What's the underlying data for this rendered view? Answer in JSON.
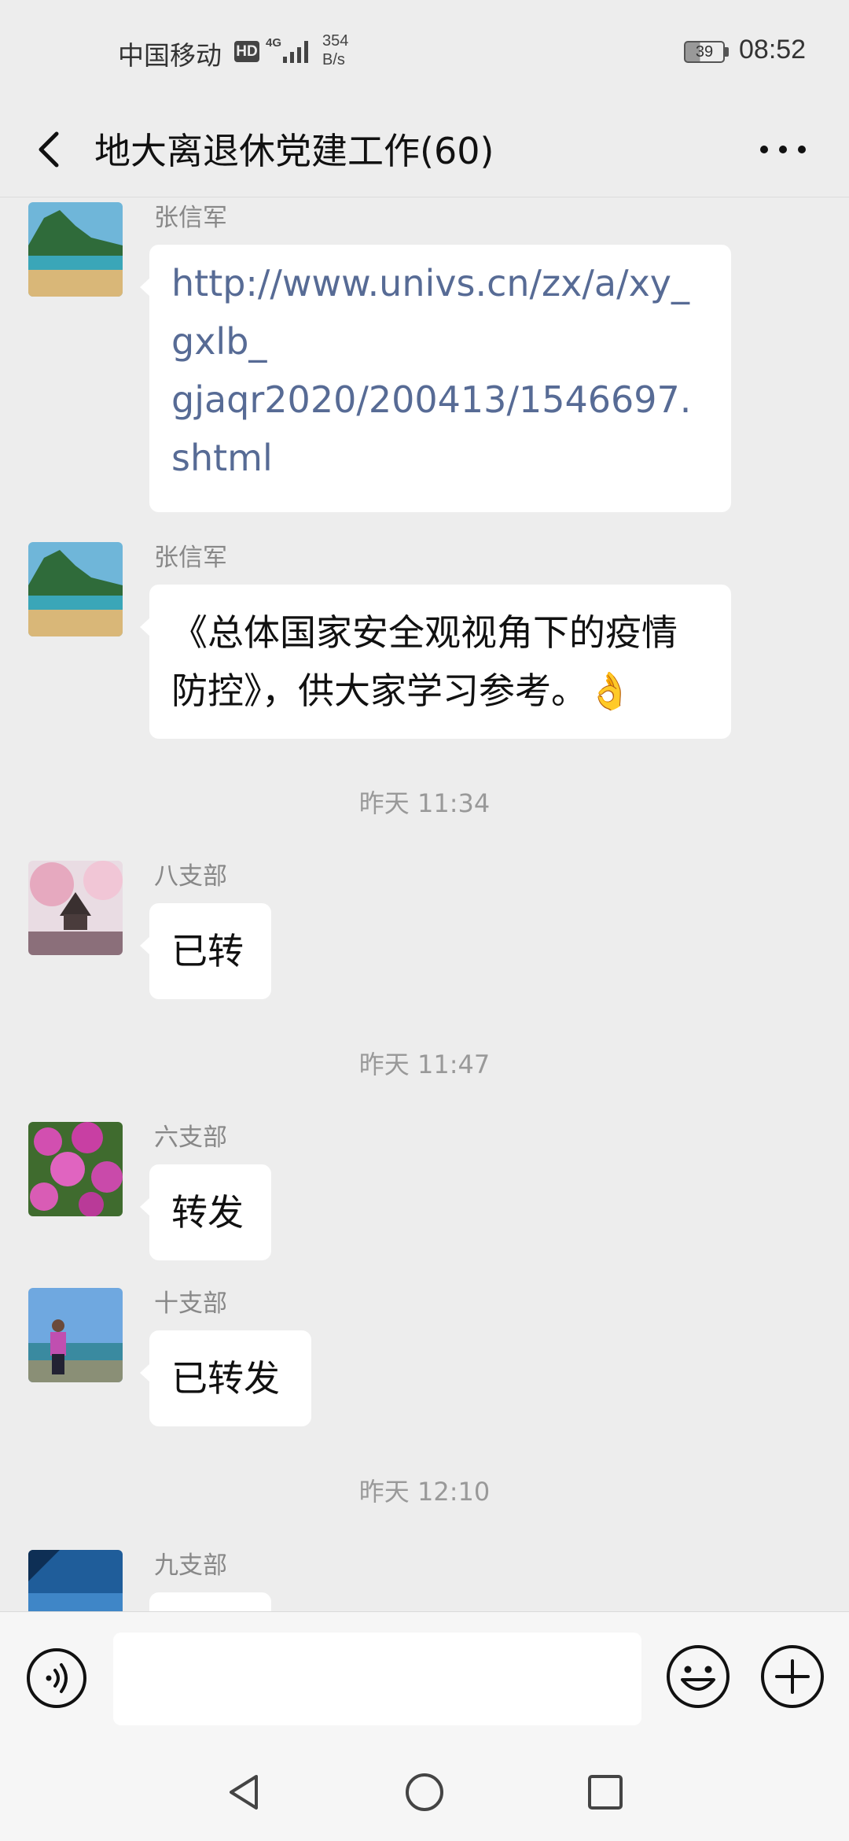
{
  "status_bar": {
    "carrier": "中国移动",
    "hd": "HD",
    "network": "4G",
    "speed_value": "354",
    "speed_unit": "B/s",
    "battery": "39",
    "time": "08:52"
  },
  "header": {
    "title": "地大离退休党建工作(60)"
  },
  "messages": [
    {
      "sender": "张信军",
      "text": "http://www.univs.cn/zx/a/xy_gxlb_gjaqr2020/200413/1546697.shtml",
      "text_lines": [
        "http://www.univs.cn/zx/a/xy_",
        "gxlb_",
        "gjaqr2020/200413/1546697.",
        "shtml"
      ],
      "is_link": true
    },
    {
      "sender": "张信军",
      "text_lines": [
        "《总体国家安全观视角下的疫情",
        "防控》，供大家学习参考。"
      ],
      "emoji": "👌"
    },
    {
      "timestamp": "昨天 11:34"
    },
    {
      "sender": "八支部",
      "text": "已转"
    },
    {
      "timestamp": "昨天 11:47"
    },
    {
      "sender": "六支部",
      "text": "转发"
    },
    {
      "sender": "十支部",
      "text": "已转发"
    },
    {
      "timestamp": "昨天 12:10"
    },
    {
      "sender": "九支部",
      "text": ""
    }
  ],
  "colors": {
    "background": "#ededed",
    "bubble": "#ffffff",
    "link": "#576b95",
    "meta_text": "#999999"
  }
}
